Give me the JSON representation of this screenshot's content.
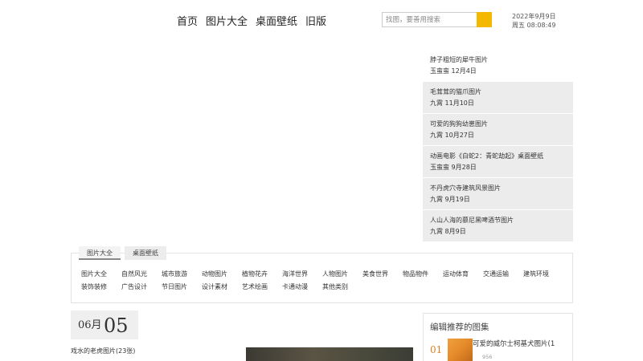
{
  "nav": {
    "items": [
      "首页",
      "图片大全",
      "桌面壁纸",
      "旧版"
    ]
  },
  "search": {
    "placeholder": "找图，要善用搜索"
  },
  "clock": {
    "date": "2022年9月9日",
    "time": "周五 08:08:49"
  },
  "news": [
    {
      "title": "脖子粗短的犀牛图片",
      "meta": "玉蛮蛮 12月4日"
    },
    {
      "title": "毛茸茸的猫爪图片",
      "meta": "九霄 11月10日"
    },
    {
      "title": "可爱的狗狗幼崽图片",
      "meta": "九霄 10月27日"
    },
    {
      "title": "动画电影《白蛇2：青蛇劫起》桌面壁纸",
      "meta": "玉蛮蛮 9月28日"
    },
    {
      "title": "不丹虎穴寺建筑风景图片",
      "meta": "九霄 9月19日"
    },
    {
      "title": "人山人海的慕尼黑啤酒节图片",
      "meta": "九霄 8月9日"
    }
  ],
  "category_tabs": [
    "图片大全",
    "桌面壁纸"
  ],
  "categories": [
    "图片大全",
    "自然风光",
    "城市旅游",
    "动物图片",
    "植物花卉",
    "海洋世界",
    "人物图片",
    "美食世界",
    "物品物件",
    "运动体育",
    "交通运输",
    "建筑环境",
    "装饰装修",
    "广告设计",
    "节日图片",
    "设计素材",
    "艺术绘画",
    "卡通动漫",
    "其他类别"
  ],
  "post": {
    "month": "06月",
    "day": "05",
    "title": "戏水的老虎图片(23张)"
  },
  "picks": {
    "title": "编辑推荐的图集",
    "items": [
      {
        "rank": "01",
        "name": "可爱的威尔士柯基犬图片(1",
        "count": "956"
      }
    ]
  }
}
